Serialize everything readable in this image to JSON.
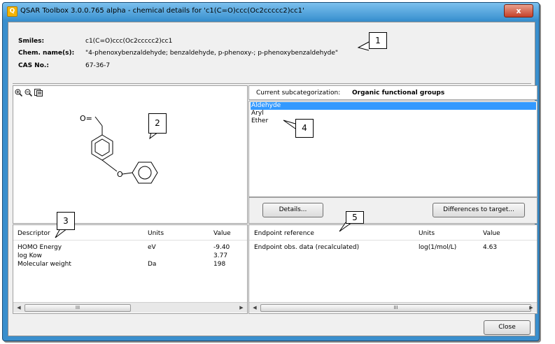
{
  "window": {
    "title": "QSAR Toolbox 3.0.0.765 alpha - chemical details for 'c1(C=O)ccc(Oc2ccccc2)cc1'",
    "app_icon_glyph": "Q",
    "close_glyph": "x"
  },
  "info": {
    "smiles_label": "Smiles:",
    "smiles_value": "c1(C=O)ccc(Oc2ccccc2)cc1",
    "name_label": "Chem. name(s):",
    "name_value": "\"4-phenoxybenzaldehyde; benzaldehyde, p-phenoxy-; p-phenoxybenzaldehyde\"",
    "cas_label": "CAS No.:",
    "cas_value": "67-36-7"
  },
  "structure": {
    "tools": [
      "zoom-in-icon",
      "zoom-out-icon",
      "copy-icon"
    ],
    "atom_aldehyde_o": "O=",
    "atom_ether_o": "O"
  },
  "subcategorization": {
    "label": "Current subcategorization:",
    "value": "Organic functional groups",
    "items": [
      "Aldehyde",
      "Aryl",
      "Ether"
    ],
    "selected_index": 0,
    "details_button": "Details...",
    "differences_button": "Differences to target..."
  },
  "descriptors": {
    "columns": [
      "Descriptor",
      "Units",
      "Value"
    ],
    "rows": [
      [
        "HOMO Energy",
        "eV",
        "-9.40"
      ],
      [
        "log Kow",
        "",
        "3.77"
      ],
      [
        "Molecular weight",
        "Da",
        "198"
      ]
    ]
  },
  "endpoints": {
    "columns": [
      "Endpoint reference",
      "Units",
      "Value"
    ],
    "rows": [
      [
        "Endpoint obs. data (recalculated)",
        "log(1/mol/L)",
        "4.63"
      ]
    ]
  },
  "scroll": {
    "left_arrow": "◀",
    "right_arrow": "▶",
    "thumb_grip": "III"
  },
  "footer": {
    "close_button": "Close"
  },
  "callouts": [
    "1",
    "2",
    "3",
    "4",
    "5"
  ]
}
